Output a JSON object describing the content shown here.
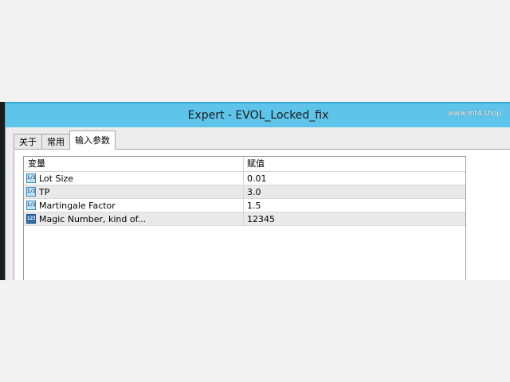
{
  "window": {
    "title": "Expert - EVOL_Locked_fix",
    "watermark": "www.mt4.shop"
  },
  "tabs": [
    {
      "label": "关于",
      "active": false
    },
    {
      "label": "常用",
      "active": false
    },
    {
      "label": "输入参数",
      "active": true
    }
  ],
  "grid": {
    "columns": {
      "name": "变量",
      "value": "赋值"
    },
    "rows": [
      {
        "icon": "double-value-icon",
        "icon_text": "1/2",
        "name": "Lot Size",
        "value": "0.01"
      },
      {
        "icon": "double-value-icon",
        "icon_text": "1/2",
        "name": "TP",
        "value": "3.0"
      },
      {
        "icon": "double-value-icon",
        "icon_text": "1/2",
        "name": "Martingale Factor",
        "value": "1.5"
      },
      {
        "icon": "integer-value-icon",
        "icon_text": "123",
        "name": "Magic Number, kind of...",
        "value": "12345"
      }
    ]
  },
  "colors": {
    "titlebar": "#5ec4ea",
    "row_alt": "#e9e9e9"
  }
}
